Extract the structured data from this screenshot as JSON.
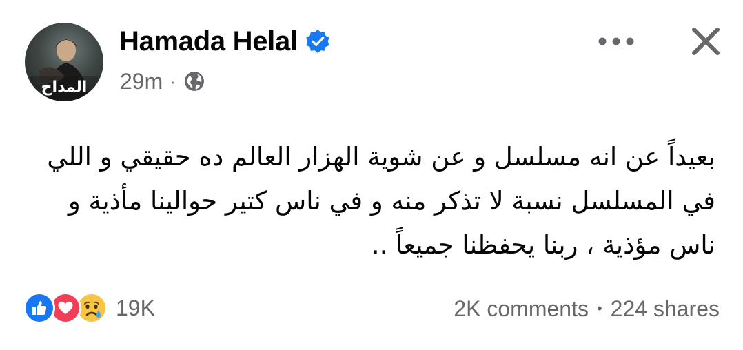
{
  "post": {
    "author": "Hamada Helal",
    "verified_icon": "verified-badge-icon",
    "time": "29m",
    "meta_separator": "·",
    "privacy_icon": "globe-icon",
    "avatar_text": "المداح",
    "text_lines": [
      "بعيداً عن انه مسلسل و عن شوية الهزار العالم ده حقيقي و اللي",
      "في المسلسل نسبة لا تذكر منه و في ناس كتير حوالينا مأذية و",
      "ناس مؤذية ، ربنا يحفظنا جميعاً .."
    ]
  },
  "header_actions": {
    "more_icon": "more-horizontal-icon",
    "close_icon": "close-icon"
  },
  "footer": {
    "reaction_icons": [
      "like-icon",
      "love-icon",
      "sad-icon"
    ],
    "reaction_count": "19K",
    "comments": "2K comments",
    "separator": "•",
    "shares": "224 shares"
  },
  "colors": {
    "text": "#050505",
    "secondary_text": "#65676b",
    "verified_blue": "#1877f2",
    "like_blue": "#1877f2",
    "love_red": "#f33e58",
    "sad_yellow": "#f7c443"
  }
}
